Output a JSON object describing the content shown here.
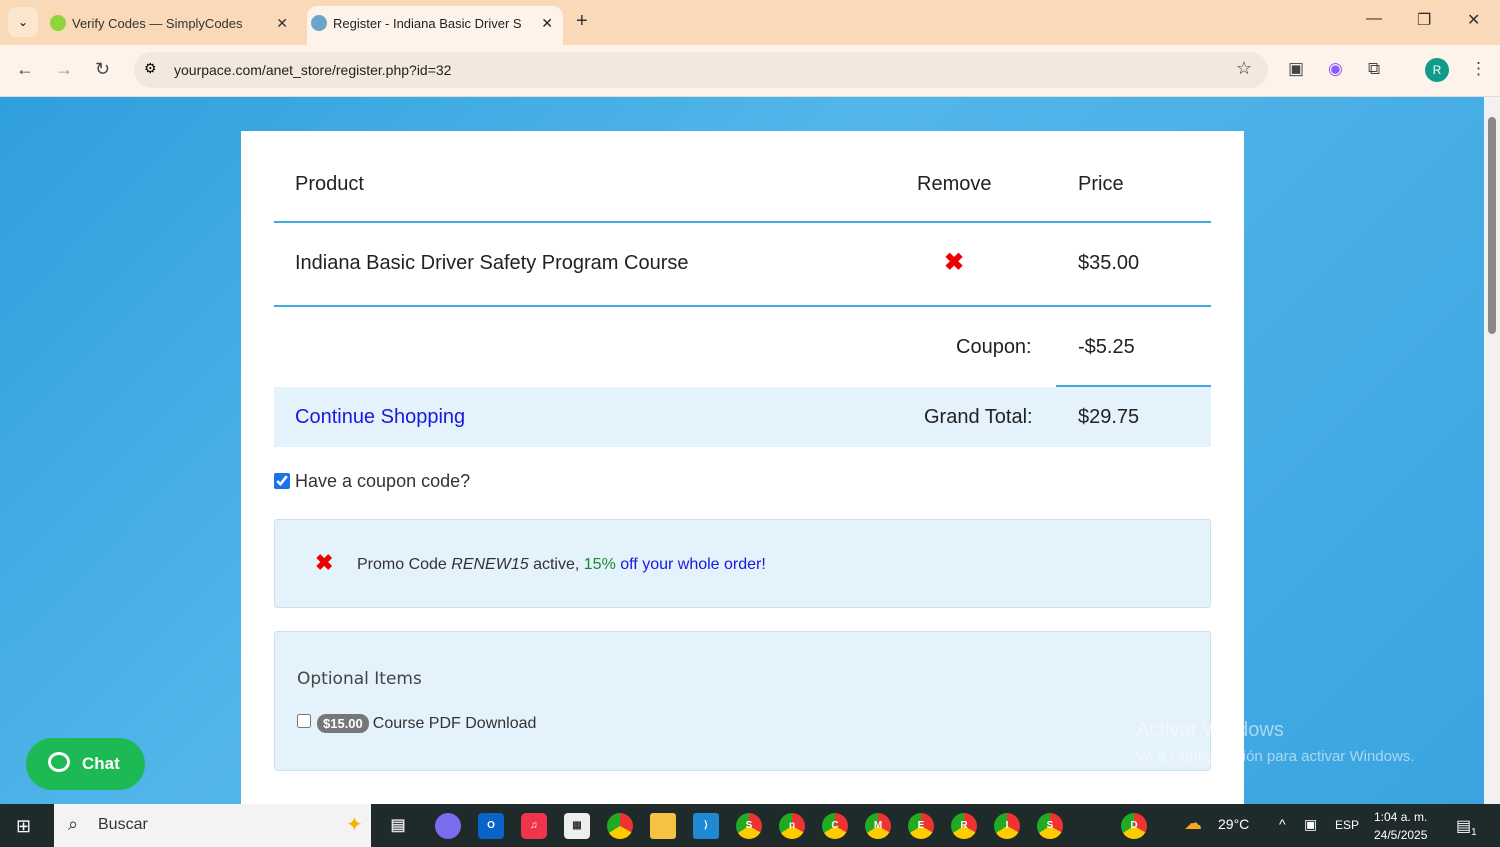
{
  "browser": {
    "tabs": [
      {
        "title": "Verify Codes — SimplyCodes",
        "active": false
      },
      {
        "title": "Register - Indiana Basic Driver S",
        "active": true
      }
    ],
    "url": "yourpace.com/anet_store/register.php?id=32",
    "profile_initial": "R"
  },
  "cart": {
    "headers": {
      "product": "Product",
      "remove": "Remove",
      "price": "Price"
    },
    "items": [
      {
        "name": "Indiana Basic Driver Safety Program Course",
        "price": "$35.00"
      }
    ],
    "coupon_label": "Coupon:",
    "coupon_value": "-$5.25",
    "continue_label": "Continue Shopping",
    "total_label": "Grand Total:",
    "total_value": "$29.75"
  },
  "coupon_toggle": {
    "label": "Have a coupon code?",
    "checked": true
  },
  "promo": {
    "prefix": "Promo Code ",
    "code": "RENEW15",
    "active": " active, ",
    "percent": "15%",
    "rest": " off your whole order!"
  },
  "optional": {
    "title": "Optional Items",
    "items": [
      {
        "price": "$15.00",
        "label": "Course PDF Download",
        "checked": false
      }
    ]
  },
  "chat": {
    "label": "Chat"
  },
  "watermark": {
    "title": "Activar Windows",
    "subtitle": "Ve a Configuración para activar Windows."
  },
  "taskbar": {
    "search": "Buscar",
    "temp": "29°C",
    "lang": "ESP",
    "time": "1:04 a. m.",
    "date": "24/5/2025",
    "notif_count": "1",
    "chrome_profiles": [
      "S",
      "n",
      "C",
      "M",
      "E",
      "R",
      "I",
      "S",
      "D"
    ]
  },
  "colors": {
    "accent": "#3fa9e0",
    "link": "#1a1adb",
    "remove": "#ee0000",
    "chat": "#1db954"
  }
}
